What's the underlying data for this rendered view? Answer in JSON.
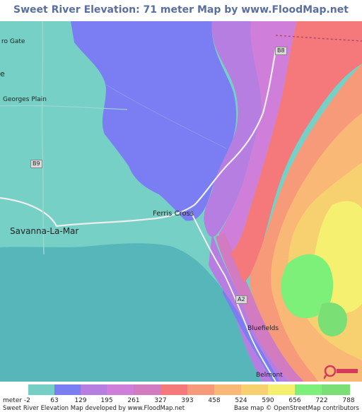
{
  "title": "Sweet River Elevation: 71 meter Map by www.FloodMap.net (beta)",
  "places": {
    "negril_gate": "ro Gate",
    "georges_plain": "Georges Plain",
    "savanna_la_mar": "Savanna-La-Mar",
    "ferris_cross": "Ferris Cross",
    "bluefields": "Bluefields",
    "belmont": "Belmont",
    "edge_e": "e"
  },
  "roads": {
    "b8": "B8",
    "b9": "B9",
    "a2": "A2"
  },
  "legend": {
    "unit_label": "meter -2",
    "ticks": [
      "63",
      "129",
      "195",
      "261",
      "327",
      "393",
      "458",
      "524",
      "590",
      "656",
      "722",
      "788"
    ],
    "colors": [
      "#75cfc4",
      "#7b7ef2",
      "#b57ee0",
      "#cf7fd9",
      "#d27bc0",
      "#f5787a",
      "#f79a79",
      "#f9b876",
      "#f7d070",
      "#f5f070",
      "#7df07a",
      "#7ae075"
    ]
  },
  "footer": {
    "left": "Sweet River Elevation Map developed by www.FloodMap.net",
    "right": "Base map © OpenStreetMap contributors"
  },
  "logo_name": "floodmap-marker"
}
